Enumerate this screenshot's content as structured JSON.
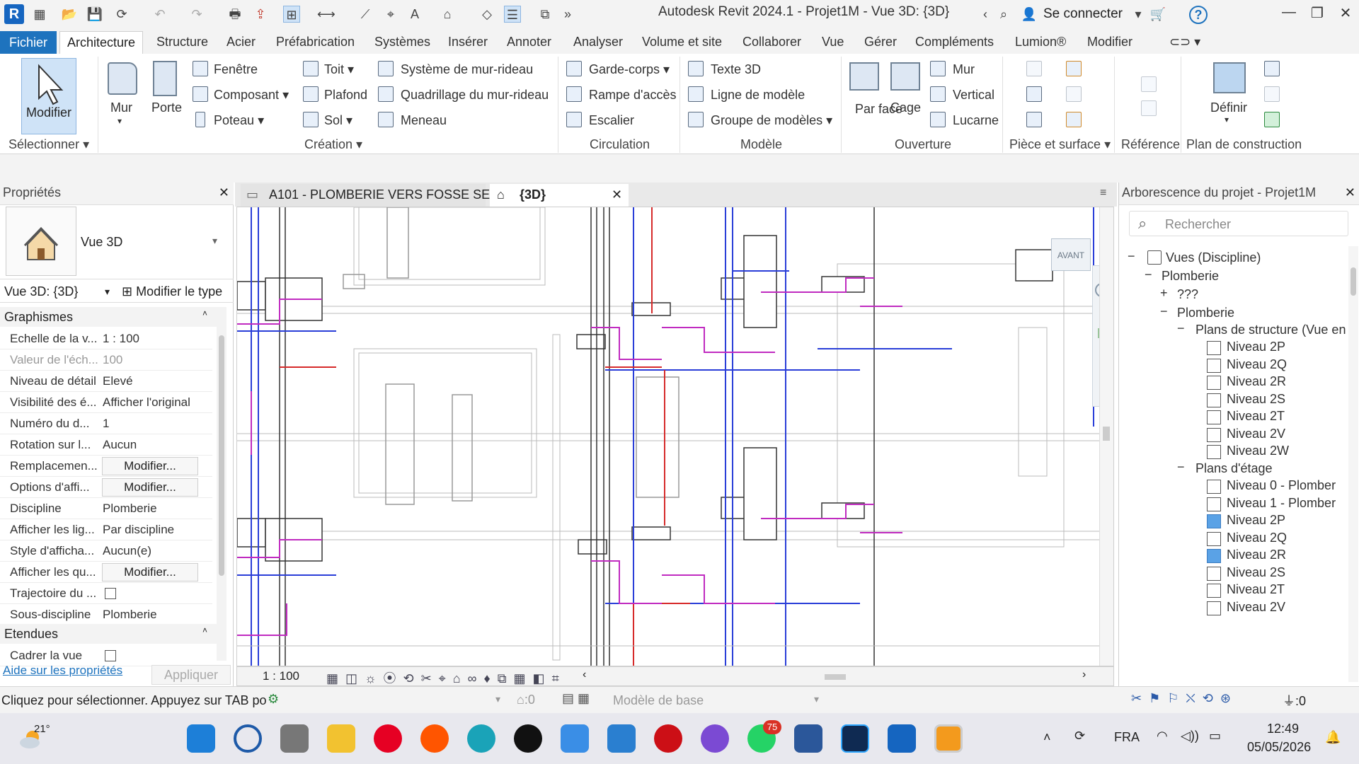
{
  "titlebar": {
    "title": "Autodesk Revit 2024.1 - Projet1M - Vue 3D: {3D}",
    "sign_in": "Se connecter",
    "logo": "R",
    "help": "?"
  },
  "menu": {
    "items": [
      "Fichier",
      "Architecture",
      "Structure",
      "Acier",
      "Préfabrication",
      "Systèmes",
      "Insérer",
      "Annoter",
      "Analyser",
      "Volume et site",
      "Collaborer",
      "Vue",
      "Gérer",
      "Compléments",
      "Lumion®",
      "Modifier"
    ]
  },
  "ribbon": {
    "select": {
      "modifier": "Modifier",
      "panel": "Sélectionner"
    },
    "build": {
      "mur": "Mur",
      "porte": "Porte",
      "fenetre": "Fenêtre",
      "composant": "Composant",
      "poteau": "Poteau",
      "toit": "Toit",
      "plafond": "Plafond",
      "sol": "Sol",
      "systeme_mur_rideau": "Système de mur-rideau",
      "quadrillage": "Quadrillage du mur-rideau",
      "meneau": "Meneau",
      "panel": "Création"
    },
    "circulation": {
      "garde_corps": "Garde-corps",
      "rampe": "Rampe d'accès",
      "escalier": "Escalier",
      "panel": "Circulation"
    },
    "model": {
      "texte3d": "Texte 3D",
      "ligne_modele": "Ligne de modèle",
      "groupe": "Groupe de modèles",
      "panel": "Modèle"
    },
    "opening": {
      "par_face": "Par face",
      "cage": "Cage",
      "mur": "Mur",
      "vertical": "Vertical",
      "lucarne": "Lucarne",
      "panel": "Ouverture"
    },
    "room": {
      "panel": "Pièce et surface"
    },
    "datum": {
      "panel": "Référence"
    },
    "workplane": {
      "definir": "Définir",
      "panel": "Plan de construction"
    }
  },
  "properties": {
    "title": "Propriétés",
    "type": "Vue 3D",
    "view_selector": "Vue 3D: {3D}",
    "edit_type": "Modifier le type",
    "section_graphics": "Graphismes",
    "section_extents": "Etendues",
    "rows": [
      {
        "label": "Echelle de la v...",
        "value": "1 : 100"
      },
      {
        "label": "Valeur de l'éch...",
        "value": "100"
      },
      {
        "label": "Niveau de détail",
        "value": "Elevé"
      },
      {
        "label": "Visibilité des é...",
        "value": "Afficher l'original"
      },
      {
        "label": "Numéro du d...",
        "value": "1"
      },
      {
        "label": "Rotation sur l...",
        "value": "Aucun"
      },
      {
        "label": "Remplacemen...",
        "value": "Modifier..."
      },
      {
        "label": "Options d'affi...",
        "value": "Modifier..."
      },
      {
        "label": "Discipline",
        "value": "Plomberie"
      },
      {
        "label": "Afficher les lig...",
        "value": "Par discipline"
      },
      {
        "label": "Style d'afficha...",
        "value": "Aucun(e)"
      },
      {
        "label": "Afficher les qu...",
        "value": "Modifier..."
      },
      {
        "label": "Trajectoire du ...",
        "value": ""
      },
      {
        "label": "Sous-discipline",
        "value": "Plomberie"
      }
    ],
    "extent_row": {
      "label": "Cadrer la vue"
    },
    "help_link": "Aide sur les propriétés",
    "apply": "Appliquer"
  },
  "tabs": [
    {
      "label": "A101 - PLOMBERIE VERS FOSSE SE..."
    },
    {
      "label": "{3D}"
    }
  ],
  "viewport": {
    "viewcube_label": "AVANT",
    "scale": "1 : 100"
  },
  "browser": {
    "title": "Arborescence du projet - Projet1M",
    "search_placeholder": "Rechercher",
    "tree": {
      "root": "Vues (Discipline)",
      "discipline": "Plomberie",
      "unknown": "???",
      "sub": "Plomberie",
      "structure_plans": "Plans de structure (Vue en",
      "floor_plans": "Plans d'étage"
    },
    "structure_levels": [
      "Niveau 2P",
      "Niveau 2Q",
      "Niveau 2R",
      "Niveau 2S",
      "Niveau 2T",
      "Niveau 2V",
      "Niveau 2W"
    ],
    "floor_levels": [
      "Niveau 0 - Plomber",
      "Niveau 1 - Plomber",
      "Niveau 2P",
      "Niveau 2Q",
      "Niveau 2R",
      "Niveau 2S",
      "Niveau 2T",
      "Niveau 2V"
    ]
  },
  "status": {
    "message": "Cliquez pour sélectionner. Appuyez sur TAB po",
    "workset": ":0",
    "model": "Modèle de base",
    "filter": ":0"
  },
  "taskbar": {
    "weather": "21°",
    "lang": "FRA",
    "time": "12:49",
    "date": "05/05/2026",
    "whatsapp_badge": "75"
  }
}
